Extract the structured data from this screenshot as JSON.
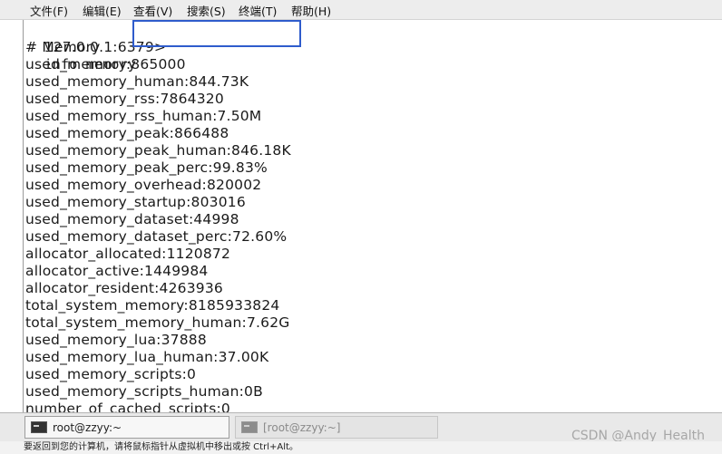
{
  "menu": [
    "文件(F)",
    "编辑(E)",
    "查看(V)",
    "搜索(S)",
    "终端(T)",
    "帮助(H)"
  ],
  "terminal": {
    "prompt": "127.0.0.1:6379>",
    "command": "info memory",
    "lines": [
      "# Memory",
      "used_memory:865000",
      "used_memory_human:844.73K",
      "used_memory_rss:7864320",
      "used_memory_rss_human:7.50M",
      "used_memory_peak:866488",
      "used_memory_peak_human:846.18K",
      "used_memory_peak_perc:99.83%",
      "used_memory_overhead:820002",
      "used_memory_startup:803016",
      "used_memory_dataset:44998",
      "used_memory_dataset_perc:72.60%",
      "allocator_allocated:1120872",
      "allocator_active:1449984",
      "allocator_resident:4263936",
      "total_system_memory:8185933824",
      "total_system_memory_human:7.62G",
      "used_memory_lua:37888",
      "used_memory_lua_human:37.00K",
      "used_memory_scripts:0",
      "used_memory_scripts_human:0B",
      "number_of_cached_scripts:0"
    ]
  },
  "taskbar": {
    "active_task": "root@zzyy:~",
    "inactive_task": "[root@zzyy:~]"
  },
  "status_text": "要返回到您的计算机，请将鼠标指针从虚拟机中移出或按 Ctrl+Alt。",
  "watermark": "CSDN @Andy_Health",
  "colors": {
    "highlight_box": "#2f5ccc"
  },
  "icons": [
    "terminal-icon"
  ]
}
